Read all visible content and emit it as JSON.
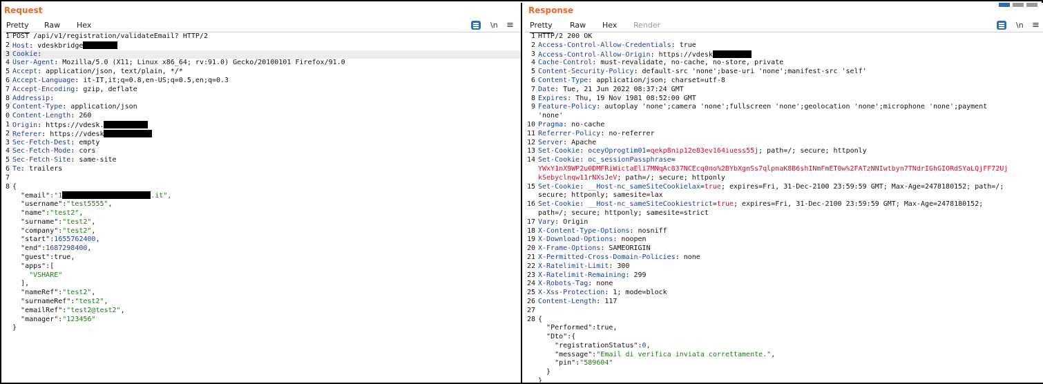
{
  "request": {
    "title": "Request",
    "tabs": [
      "Pretty",
      "Raw",
      "Hex"
    ],
    "newline_toggle": "\\n",
    "menu_glyph": "≡",
    "headers": [
      {
        "n": "1",
        "text": "POST /api/v1/registration/validateEmail? HTTP/2"
      },
      {
        "n": "2",
        "name": "Host",
        "value": "vdeskbridge"
      },
      {
        "n": "3",
        "name": "Cookie",
        "value": ""
      },
      {
        "n": "4",
        "name": "User-Agent",
        "value": "Mozilla/5.0 (X11; Linux x86_64; rv:91.0) Gecko/20100101 Firefox/91.0"
      },
      {
        "n": "5",
        "name": "Accept",
        "value": "application/json, text/plain, */*"
      },
      {
        "n": "6",
        "name": "Accept-Language",
        "value": "it-IT,it;q=0.8,en-US;q=0.5,en;q=0.3"
      },
      {
        "n": "7",
        "name": "Accept-Encoding",
        "value": "gzip, deflate"
      },
      {
        "n": "8",
        "name": "Addressip",
        "value": ""
      },
      {
        "n": "9",
        "name": "Content-Type",
        "value": "application/json"
      },
      {
        "n": "0",
        "name": "Content-Length",
        "value": "260"
      },
      {
        "n": "1",
        "name": "Origin",
        "value": "https://vdesk."
      },
      {
        "n": "2",
        "name": "Referer",
        "value": "https://vdesk"
      },
      {
        "n": "3",
        "name": "Sec-Fetch-Dest",
        "value": "empty"
      },
      {
        "n": "4",
        "name": "Sec-Fetch-Mode",
        "value": "cors"
      },
      {
        "n": "5",
        "name": "Sec-Fetch-Site",
        "value": "same-site"
      },
      {
        "n": "6",
        "name": "Te",
        "value": "trailers"
      }
    ],
    "blank_line": "7",
    "json_open": {
      "n": "8",
      "text": "{"
    },
    "json_lines": [
      {
        "indent": 1,
        "key": "\"email\"",
        "prefix": ":\"1",
        "suffix": ".it\",",
        "type": "str"
      },
      {
        "indent": 1,
        "key": "\"username\"",
        "value": "\"test5555\"",
        "type": "str",
        "comma": ","
      },
      {
        "indent": 1,
        "key": "\"name\"",
        "value": "\"test2\"",
        "type": "str",
        "comma": ","
      },
      {
        "indent": 1,
        "key": "\"surname\"",
        "value": "\"test2\"",
        "type": "str",
        "comma": ","
      },
      {
        "indent": 1,
        "key": "\"company\"",
        "value": "\"test2\"",
        "type": "str",
        "comma": ","
      },
      {
        "indent": 1,
        "key": "\"start\"",
        "value": "1655762400",
        "type": "num",
        "comma": ","
      },
      {
        "indent": 1,
        "key": "\"end\"",
        "value": "1687298400",
        "type": "num",
        "comma": ","
      },
      {
        "indent": 1,
        "key": "\"guest\"",
        "value": "true",
        "type": "plain",
        "comma": ","
      },
      {
        "indent": 1,
        "key": "\"apps\"",
        "value": "[",
        "type": "plain",
        "comma": ""
      },
      {
        "indent": 2,
        "raw": "\"VSHARE\"",
        "type": "str"
      },
      {
        "indent": 1,
        "raw": "],",
        "type": "plain"
      },
      {
        "indent": 1,
        "key": "\"nameRef\"",
        "value": "\"test2\"",
        "type": "str",
        "comma": ","
      },
      {
        "indent": 1,
        "key": "\"surnameRef\"",
        "value": "\"test2\"",
        "type": "str",
        "comma": ","
      },
      {
        "indent": 1,
        "key": "\"emailRef\"",
        "value": "\"test2@test2\"",
        "type": "str",
        "comma": ","
      },
      {
        "indent": 1,
        "key": "\"manager\"",
        "value": "\"123456\"",
        "type": "str",
        "comma": ""
      },
      {
        "indent": 0,
        "raw": "}",
        "type": "plain"
      }
    ]
  },
  "response": {
    "title": "Response",
    "tabs": [
      "Pretty",
      "Raw",
      "Hex",
      "Render"
    ],
    "newline_toggle": "\\n",
    "menu_glyph": "≡",
    "headers": [
      {
        "n": "1",
        "text": "HTTP/2 200 OK"
      },
      {
        "n": "2",
        "name": "Access-Control-Allow-Credentials",
        "value": "true"
      },
      {
        "n": "3",
        "name": "Access-Control-Allow-Origin",
        "value": "https://vdesk"
      },
      {
        "n": "4",
        "name": "Cache-Control",
        "value": "must-revalidate, no-cache, no-store, private"
      },
      {
        "n": "5",
        "name": "Content-Security-Policy",
        "value": "default-src 'none';base-uri 'none';manifest-src 'self'"
      },
      {
        "n": "6",
        "name": "Content-Type",
        "value": "application/json; charset=utf-8"
      },
      {
        "n": "7",
        "name": "Date",
        "value": "Tue, 21 Jun 2022 08:37:24 GMT"
      },
      {
        "n": "8",
        "name": "Expires",
        "value": "Thu, 19 Nov 1981 08:52:00 GMT"
      },
      {
        "n": "9",
        "name": "Feature-Policy",
        "value": "autoplay 'none';camera 'none';fullscreen 'none';geolocation 'none';microphone 'none';payment"
      },
      {
        "n": "",
        "cont": "'none'"
      },
      {
        "n": "10",
        "name": "Pragma",
        "value": "no-cache"
      },
      {
        "n": "11",
        "name": "Referrer-Policy",
        "value": "no-referrer"
      },
      {
        "n": "12",
        "name": "Server",
        "value": "Apache"
      },
      {
        "n": "13",
        "name": "Set-Cookie",
        "ck": "oceyOprogtim01",
        "cv": "qekp8nip12e83ev164iuess55j",
        "rest": "; path=/; secure; httponly"
      },
      {
        "n": "14",
        "name": "Set-Cookie",
        "ck": "oc_sessionPassphrase",
        "rest": "="
      },
      {
        "n": "",
        "cvline": "YWxY1nX9WP2u0DMFRiWictaEli7MNqAc837NCEcq0no%2BYbXgnSs7qlpnaK8B6shINmFmET0w%2FATzNNIwtbyn7TNdrIGhGIORdSYaLQjFF72Uj"
      },
      {
        "n": "",
        "cvline": "kSebyclnqw11rNXsJeV",
        "rest": "; path=/; secure; httponly"
      },
      {
        "n": "15",
        "name": "Set-Cookie",
        "ck": "__Host-nc_sameSiteCookielax",
        "cv": "true",
        "rest": "; expires=Fri, 31-Dec-2100 23:59:59 GMT; Max-Age=2478180152; path=/;"
      },
      {
        "n": "",
        "cont": "secure; httponly; samesite=lax"
      },
      {
        "n": "16",
        "name": "Set-Cookie",
        "ck": "__Host-nc_sameSiteCookiestrict",
        "cv": "true",
        "rest": "; expires=Fri, 31-Dec-2100 23:59:59 GMT; Max-Age=2478180152;"
      },
      {
        "n": "",
        "cont": "path=/; secure; httponly; samesite=strict"
      },
      {
        "n": "17",
        "name": "Vary",
        "value": "Origin"
      },
      {
        "n": "18",
        "name": "X-Content-Type-Options",
        "value": "nosniff"
      },
      {
        "n": "19",
        "name": "X-Download-Options",
        "value": "noopen"
      },
      {
        "n": "20",
        "name": "X-Frame-Options",
        "value": "SAMEORIGIN"
      },
      {
        "n": "21",
        "name": "X-Permitted-Cross-Domain-Policies",
        "value": "none"
      },
      {
        "n": "22",
        "name": "X-Ratelimit-Limit",
        "value": "300"
      },
      {
        "n": "23",
        "name": "X-Ratelimit-Remaining",
        "value": "299"
      },
      {
        "n": "24",
        "name": "X-Robots-Tag",
        "value": "none"
      },
      {
        "n": "25",
        "name": "X-Xss-Protection",
        "value": "1; mode=block"
      },
      {
        "n": "26",
        "name": "Content-Length",
        "value": "117"
      }
    ],
    "blank_line": "27",
    "json_open": {
      "n": "28",
      "text": "{"
    },
    "json_lines": [
      {
        "indent": 1,
        "key": "\"Performed\"",
        "value": "true",
        "type": "plain",
        "comma": ","
      },
      {
        "indent": 1,
        "key": "\"Dto\"",
        "value": "{",
        "type": "plain",
        "comma": ""
      },
      {
        "indent": 2,
        "key": "\"registrationStatus\"",
        "value": "0",
        "type": "num",
        "comma": ","
      },
      {
        "indent": 2,
        "key": "\"message\"",
        "value": "\"Email di verifica inviata correttamente.\"",
        "type": "str",
        "comma": ","
      },
      {
        "indent": 2,
        "key": "\"pin\"",
        "value": "\"589604\"",
        "type": "str",
        "comma": ""
      },
      {
        "indent": 1,
        "raw": "}",
        "type": "plain"
      },
      {
        "indent": 0,
        "raw": "}",
        "type": "plain"
      }
    ]
  },
  "colors": {
    "title": "#e8692a",
    "header_name": "#1d3e9c",
    "string": "#1b7a15",
    "number": "#1d3e9c",
    "cookie_value": "#c8102e",
    "accent": "#2f6db3"
  }
}
